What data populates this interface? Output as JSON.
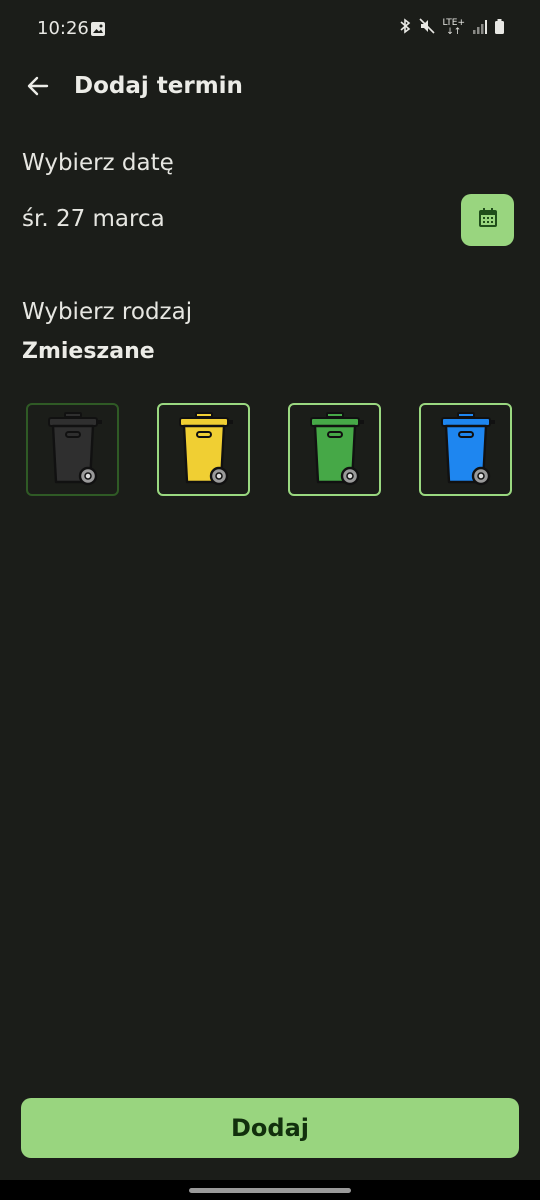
{
  "status_bar": {
    "time": "10:26",
    "network": "LTE+",
    "icons": [
      "image-icon",
      "bluetooth-icon",
      "mute-icon",
      "signal-icon",
      "battery-icon"
    ]
  },
  "header": {
    "title": "Dodaj termin",
    "back_icon": "arrow-left-icon"
  },
  "date_section": {
    "label": "Wybierz datę",
    "value": "śr. 27 marca",
    "calendar_icon": "calendar-icon"
  },
  "type_section": {
    "label": "Wybierz rodzaj",
    "selected": "Zmieszane",
    "bins": [
      {
        "color": "#2f2f2f",
        "selected": true
      },
      {
        "color": "#f0cf33",
        "selected": false
      },
      {
        "color": "#46a847",
        "selected": false
      },
      {
        "color": "#1e86f0",
        "selected": false
      }
    ]
  },
  "add_button": {
    "label": "Dodaj"
  },
  "colors": {
    "accent": "#99d57f",
    "background": "#1b1d19"
  }
}
